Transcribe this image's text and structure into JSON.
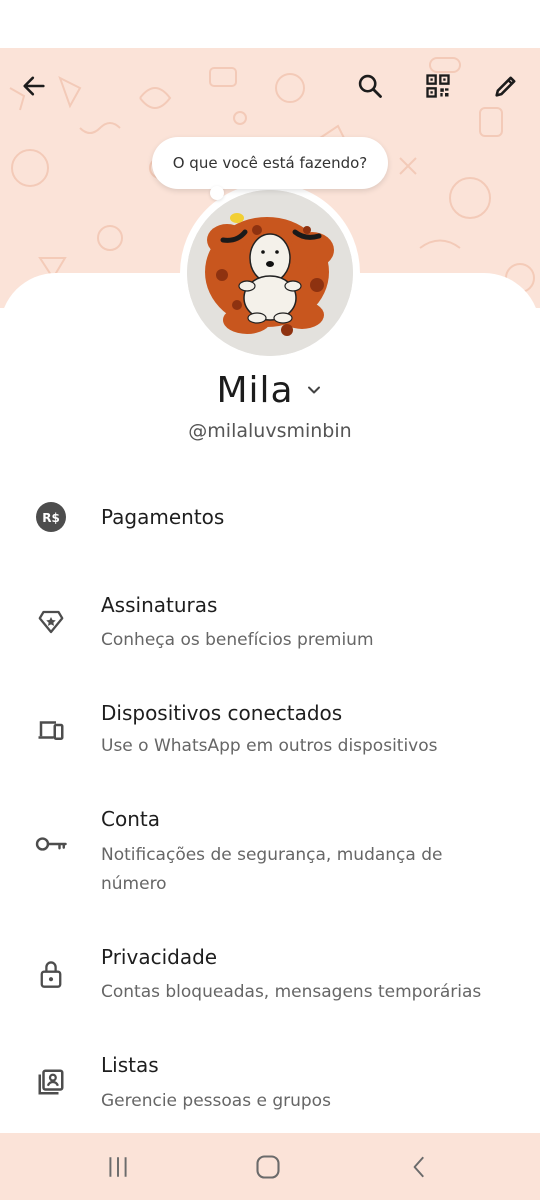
{
  "header": {
    "back_icon": "arrow-left-icon",
    "search_icon": "search-icon",
    "qr_icon": "qr-code-icon",
    "edit_icon": "pencil-icon",
    "background_color": "#fbe3d8"
  },
  "status_bubble": {
    "text": "O que você está fazendo?"
  },
  "profile": {
    "name": "Mila",
    "username": "@milaluvsminbin"
  },
  "menu": [
    {
      "icon": "currency-brl-icon",
      "title": "Pagamentos",
      "subtitle": ""
    },
    {
      "icon": "badge-star-icon",
      "title": "Assinaturas",
      "subtitle": "Conheça os benefícios premium"
    },
    {
      "icon": "devices-icon",
      "title": "Dispositivos conectados",
      "subtitle": "Use o WhatsApp em outros dispositivos"
    },
    {
      "icon": "key-icon",
      "title": "Conta",
      "subtitle": "Notificações de segurança, mudança de número"
    },
    {
      "icon": "lock-icon",
      "title": "Privacidade",
      "subtitle": "Contas bloqueadas, mensagens temporárias"
    },
    {
      "icon": "contacts-list-icon",
      "title": "Listas",
      "subtitle": "Gerencie pessoas e grupos"
    }
  ],
  "icon_badge_text": "R$",
  "navbar": {
    "recents_icon": "recents-icon",
    "home_icon": "home-icon",
    "back_icon": "nav-back-icon"
  }
}
